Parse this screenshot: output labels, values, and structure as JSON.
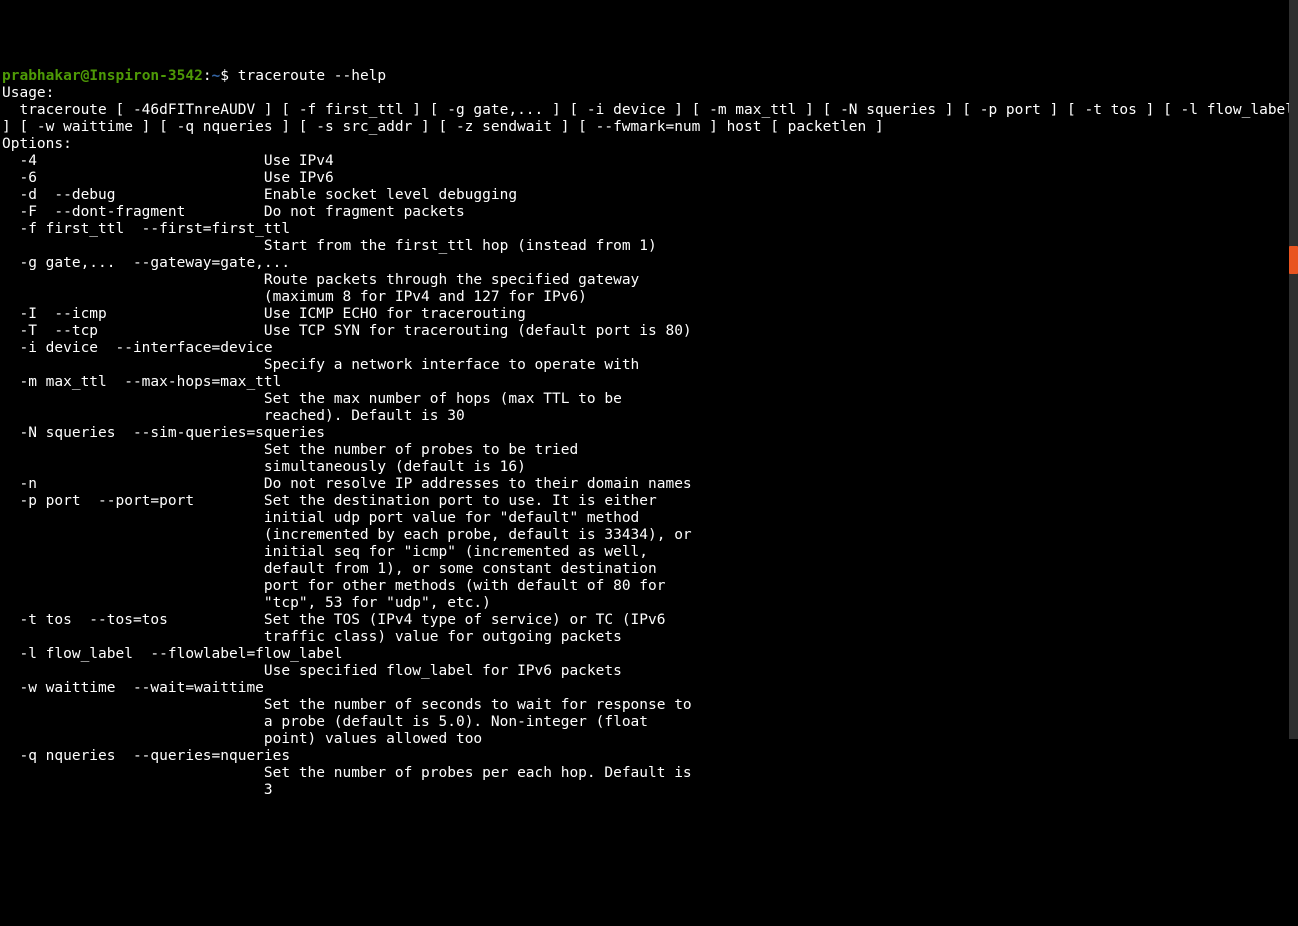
{
  "prompt": {
    "user": "prabhakar",
    "at": "@",
    "host": "Inspiron-3542",
    "colon": ":",
    "path": "~",
    "dollar": "$ "
  },
  "command": "traceroute --help",
  "lines": [
    "Usage:",
    "  traceroute [ -46dFITnreAUDV ] [ -f first_ttl ] [ -g gate,... ] [ -i device ] [ -m max_ttl ] [ -N squeries ] [ -p port ] [ -t tos ] [ -l flow_label ] [ -w waittime ] [ -q nqueries ] [ -s src_addr ] [ -z sendwait ] [ --fwmark=num ] host [ packetlen ]",
    "Options:",
    "  -4                          Use IPv4",
    "  -6                          Use IPv6",
    "  -d  --debug                 Enable socket level debugging",
    "  -F  --dont-fragment         Do not fragment packets",
    "  -f first_ttl  --first=first_ttl",
    "                              Start from the first_ttl hop (instead from 1)",
    "  -g gate,...  --gateway=gate,...",
    "                              Route packets through the specified gateway",
    "                              (maximum 8 for IPv4 and 127 for IPv6)",
    "  -I  --icmp                  Use ICMP ECHO for tracerouting",
    "  -T  --tcp                   Use TCP SYN for tracerouting (default port is 80)",
    "  -i device  --interface=device",
    "                              Specify a network interface to operate with",
    "  -m max_ttl  --max-hops=max_ttl",
    "                              Set the max number of hops (max TTL to be",
    "                              reached). Default is 30",
    "  -N squeries  --sim-queries=squeries",
    "                              Set the number of probes to be tried",
    "                              simultaneously (default is 16)",
    "  -n                          Do not resolve IP addresses to their domain names",
    "  -p port  --port=port        Set the destination port to use. It is either",
    "                              initial udp port value for \"default\" method",
    "                              (incremented by each probe, default is 33434), or",
    "                              initial seq for \"icmp\" (incremented as well,",
    "                              default from 1), or some constant destination",
    "                              port for other methods (with default of 80 for",
    "                              \"tcp\", 53 for \"udp\", etc.)",
    "  -t tos  --tos=tos           Set the TOS (IPv4 type of service) or TC (IPv6",
    "                              traffic class) value for outgoing packets",
    "  -l flow_label  --flowlabel=flow_label",
    "                              Use specified flow_label for IPv6 packets",
    "  -w waittime  --wait=waittime",
    "                              Set the number of seconds to wait for response to",
    "                              a probe (default is 5.0). Non-integer (float",
    "                              point) values allowed too",
    "  -q nqueries  --queries=nqueries",
    "                              Set the number of probes per each hop. Default is",
    "                              3"
  ],
  "scrollbar": {
    "accent": "#e95420"
  }
}
